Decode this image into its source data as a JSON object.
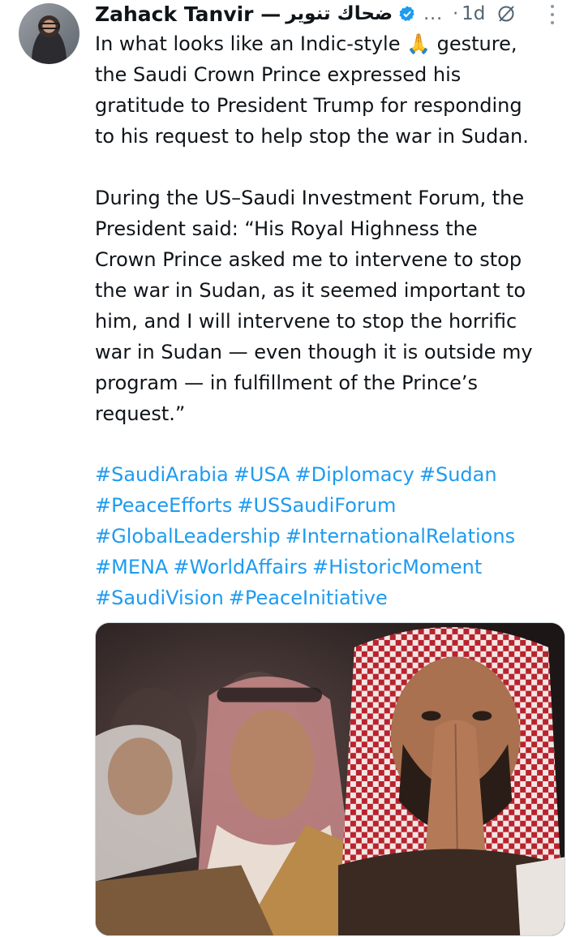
{
  "post": {
    "author_name": "Zahack Tanvir —",
    "author_name_ar": "ضحاك تنوير",
    "more_dots": "...",
    "separator": "·",
    "time": "1d",
    "icons": {
      "avatar": "avatar",
      "verified": "verified-badge-icon",
      "grok": "grok-icon",
      "more": "more-options-icon"
    },
    "accent_color": "#1d9bf0",
    "emoji": "🙏",
    "body_lines_1": [
      "In what looks like an Indic-style 🙏 gesture,",
      "the Saudi Crown Prince expressed his",
      "gratitude to President Trump for responding",
      "to his request to help stop the war in Sudan."
    ],
    "body_lines_2": [
      "During the US–Saudi Investment Forum, the",
      "President said: “His Royal Highness the",
      "Crown Prince asked me to intervene to stop",
      "the war in Sudan, as it seemed important to",
      "him, and I will intervene to stop the horrific",
      "war in Sudan — even though it is outside my",
      "program — in fulfillment of the Prince’s",
      "request.”"
    ],
    "hashtag_lines": [
      [
        "#SaudiArabia",
        "#USA",
        "#Diplomacy",
        "#Sudan"
      ],
      [
        "#PeaceEfforts",
        "#USSaudiForum"
      ],
      [
        "#GlobalLeadership",
        "#InternationalRelations"
      ],
      [
        "#MENA",
        "#WorldAffairs",
        "#HistoricMoment"
      ],
      [
        "#SaudiVision",
        "#PeaceInitiative"
      ]
    ]
  }
}
